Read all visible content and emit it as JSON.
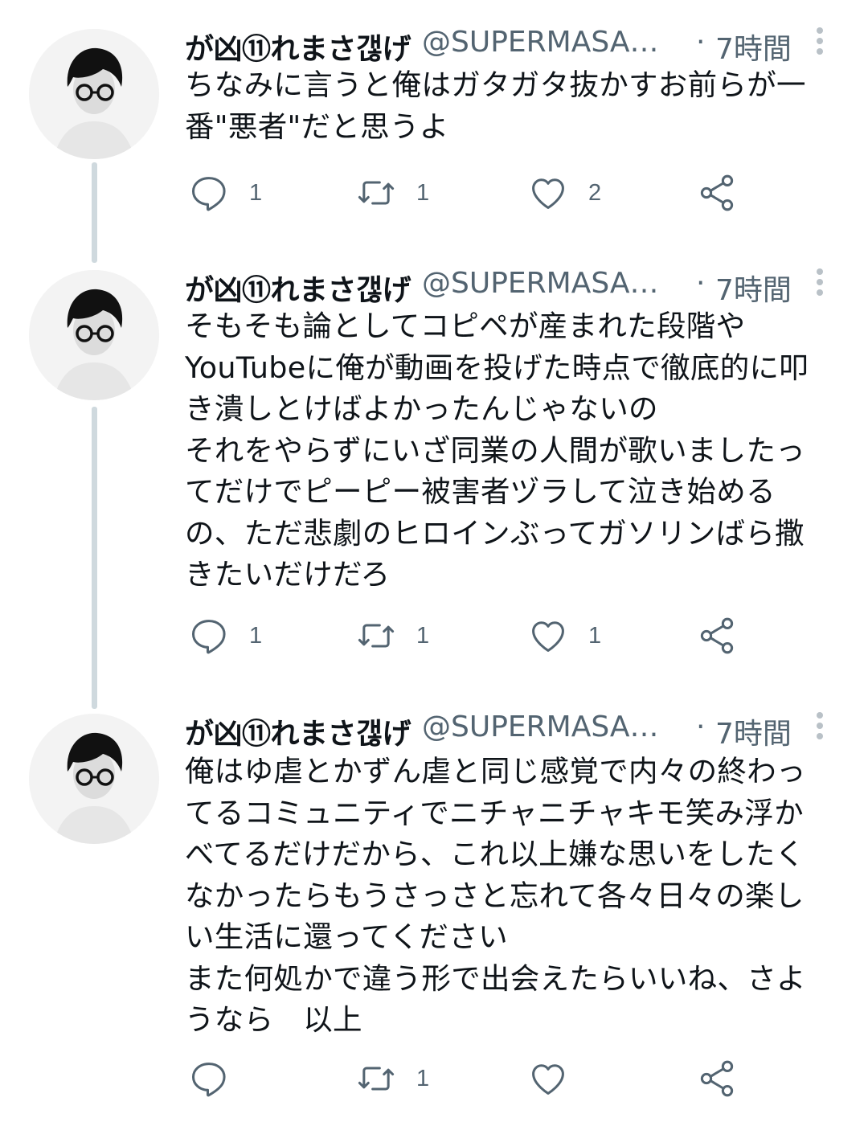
{
  "tweets": [
    {
      "name": "が凶⑪れまさ갢げ",
      "handle": "@SUPERMASAS...",
      "dot": "·",
      "time": "7時間",
      "text": "ちなみに言うと俺はガタガタ抜かすお前らが一\n番\"悪者\"だと思うよ",
      "replies": "1",
      "retweets": "1",
      "likes": "2"
    },
    {
      "name": "が凶⑪れまさ갢げ",
      "handle": "@SUPERMASAS...",
      "dot": "·",
      "time": "7時間",
      "text": "そもそも論としてコピペが産まれた段階や\nYouTubeに俺が動画を投げた時点で徹底的に叩\nき潰しとけばよかったんじゃないの\nそれをやらずにいざ同業の人間が歌いましたっ\nてだけでピーピー被害者ヅラして泣き始める\nの、ただ悲劇のヒロインぶってガソリンばら撒\nきたいだけだろ",
      "replies": "1",
      "retweets": "1",
      "likes": "1"
    },
    {
      "name": "が凶⑪れまさ갢げ",
      "handle": "@SUPERMASAS...",
      "dot": "·",
      "time": "7時間",
      "text": "俺はゆ虐とかずん虐と同じ感覚で内々の終わっ\nてるコミュニティでニチャニチャキモ笑み浮か\nべてるだけだから、これ以上嫌な思いをしたく\nなかったらもうさっさと忘れて各々日々の楽し\nい生活に還ってください\nまた何処かで違う形で出会えたらいいね、さよ\nうなら　以上",
      "replies": "",
      "retweets": "1",
      "likes": ""
    }
  ],
  "icons": {
    "reply": "reply-icon",
    "retweet": "retweet-icon",
    "like": "heart-icon",
    "share": "share-icon",
    "more": "more-vertical-icon"
  },
  "colors": {
    "text": "#0f1419",
    "secondary": "#536471",
    "thread_line": "#cfd9de"
  }
}
